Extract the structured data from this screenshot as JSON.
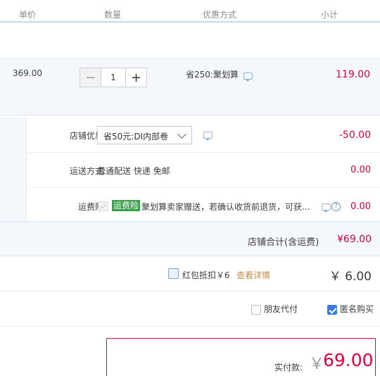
{
  "header": {
    "col_unit_price": "单价",
    "col_quantity": "数量",
    "col_promotion": "优惠方式",
    "col_subtotal": "小计"
  },
  "item": {
    "unit_price": "369.00",
    "minus_icon": "−",
    "quantity": "1",
    "plus_icon": "+",
    "promotion": "省250:聚划算",
    "subtotal": "119.00"
  },
  "shop": {
    "discount_label": "店铺优惠:",
    "discount_selected": "省50元:DI内部卷",
    "discount_value": "-50.00",
    "shipping_label": "运送方式:",
    "shipping_value": "普通配送 快递 免邮",
    "shipping_cost": "0.00",
    "insurance_label": "运费险:",
    "insurance_badge": "运费险",
    "insurance_text": "聚划算卖家赠送，若确认收货前退货，可获...",
    "insurance_help_icon": "?",
    "insurance_cost": "0.00"
  },
  "total": {
    "label": "店铺合计(含运费)",
    "value": "¥69.00"
  },
  "redpack": {
    "label": "红包抵扣￥6",
    "link": "查看详情",
    "value": "￥ 6.00"
  },
  "options": {
    "friend_pay": "朋友代付",
    "anonymous": "匿名购买",
    "anonymous_checked": true
  },
  "payment": {
    "label": "实付款:",
    "currency": "￥",
    "amount": "69.00"
  },
  "colors": {
    "accent_red": "#e1003a",
    "price_red": "#d6003a",
    "link_orange": "#c98a4a",
    "checkbox_blue": "#3a7be0",
    "badge_green": "#3aa14a"
  }
}
